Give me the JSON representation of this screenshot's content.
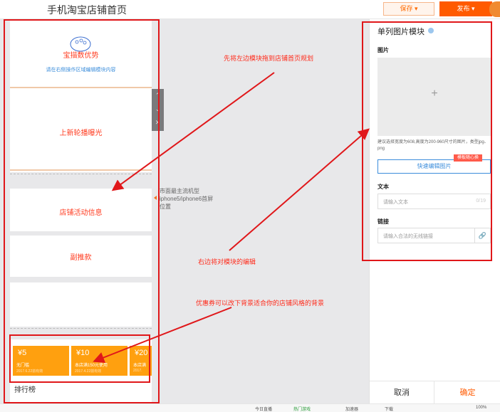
{
  "header": {
    "title": "手机淘宝店铺首页",
    "save_label": "保存 ▾",
    "publish_label": "发布 ▾"
  },
  "phone": {
    "hero": {
      "title": "宝描数优势",
      "hint": "请在右侧操作区域编辑模块内容"
    },
    "carousel_label": "上新轮播曝光",
    "activity_label": "店铺活动信息",
    "bestseller_label": "副推款",
    "coupons": [
      {
        "amount": "¥5",
        "condition": "无门槛",
        "validity": "2017.6.22前有效"
      },
      {
        "amount": "¥10",
        "condition": "本店满150元使用",
        "validity": "2017.4.22前有效"
      },
      {
        "amount": "¥20",
        "condition": "本店满",
        "validity": "2017."
      }
    ],
    "rank_label": "排行榜"
  },
  "side_controls": [
    "⌃",
    "⌄",
    "✕"
  ],
  "tip": "市面最主流机型iphone5/iphone6首屏位置",
  "annotations": {
    "drag_hint": "先将左边模块拖到店铺首页规划",
    "edit_hint": "右边将对模块的编辑",
    "coupon_hint": "优惠券可以改下背景适合你的店铺风格的背景"
  },
  "panel": {
    "title": "单列图片模块",
    "image_label": "图片",
    "plus": "+",
    "image_note": "建议选择宽度为608,高度为200-960尺寸的图片，类型jpg、png",
    "edit_button": "快速编辑图片",
    "edit_badge": "模板随心换",
    "text_label": "文本",
    "text_placeholder": "请输入文本",
    "text_count": "0/19",
    "link_label": "链接",
    "link_placeholder": "请输入合法的无线链接",
    "cancel": "取消",
    "confirm": "确定"
  },
  "statusbar": [
    "今日直播",
    "热门游戏",
    "加速器",
    "下载",
    "100%"
  ],
  "colors": {
    "accent": "#ff5a00",
    "annotation": "#e0171a",
    "coupon": "#ffa00f",
    "link": "#3b8ddb"
  }
}
